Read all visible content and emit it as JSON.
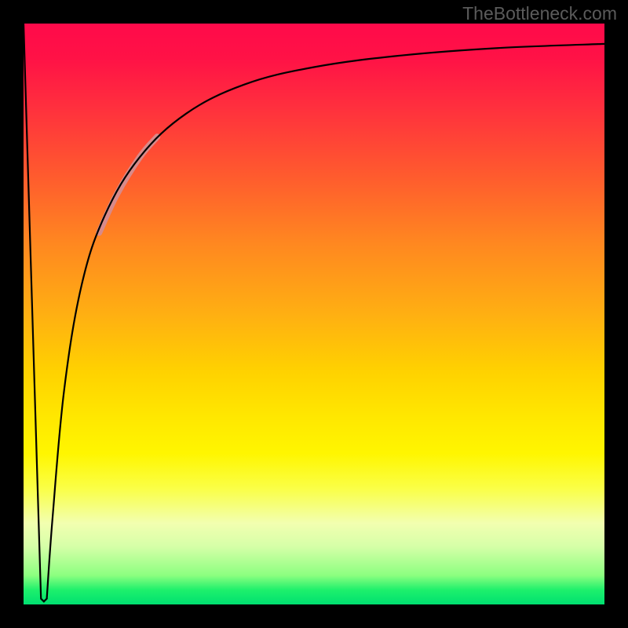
{
  "watermark": "TheBottleneck.com",
  "chart_data": {
    "type": "line",
    "title": "",
    "xlabel": "",
    "ylabel": "",
    "xlim": [
      0,
      100
    ],
    "ylim": [
      0,
      100
    ],
    "background_gradient": {
      "direction": "vertical",
      "stops": [
        {
          "pos": 0.0,
          "color": "#ff0a4a"
        },
        {
          "pos": 0.5,
          "color": "#ffb800"
        },
        {
          "pos": 0.78,
          "color": "#fff600"
        },
        {
          "pos": 0.97,
          "color": "#1ef06c"
        },
        {
          "pos": 1.0,
          "color": "#00e070"
        }
      ]
    },
    "series": [
      {
        "name": "left-spike",
        "color": "#000000",
        "width": 2,
        "points": [
          {
            "x": 0.0,
            "y": 100.0
          },
          {
            "x": 3.0,
            "y": 1.0
          },
          {
            "x": 3.5,
            "y": 0.5
          },
          {
            "x": 4.0,
            "y": 1.0
          }
        ]
      },
      {
        "name": "main-curve",
        "color": "#000000",
        "width": 2,
        "points": [
          {
            "x": 4.0,
            "y": 1.0
          },
          {
            "x": 5.0,
            "y": 15.0
          },
          {
            "x": 7.0,
            "y": 37.0
          },
          {
            "x": 10.0,
            "y": 55.0
          },
          {
            "x": 14.0,
            "y": 67.0
          },
          {
            "x": 20.0,
            "y": 77.0
          },
          {
            "x": 28.0,
            "y": 84.5
          },
          {
            "x": 38.0,
            "y": 89.5
          },
          {
            "x": 50.0,
            "y": 92.5
          },
          {
            "x": 65.0,
            "y": 94.5
          },
          {
            "x": 82.0,
            "y": 95.8
          },
          {
            "x": 100.0,
            "y": 96.5
          }
        ]
      },
      {
        "name": "highlight-segment",
        "color": "#d88a8a",
        "width": 8,
        "points": [
          {
            "x": 13.0,
            "y": 64.0
          },
          {
            "x": 16.0,
            "y": 70.5
          },
          {
            "x": 20.0,
            "y": 77.0
          },
          {
            "x": 23.0,
            "y": 80.5
          }
        ]
      }
    ]
  }
}
